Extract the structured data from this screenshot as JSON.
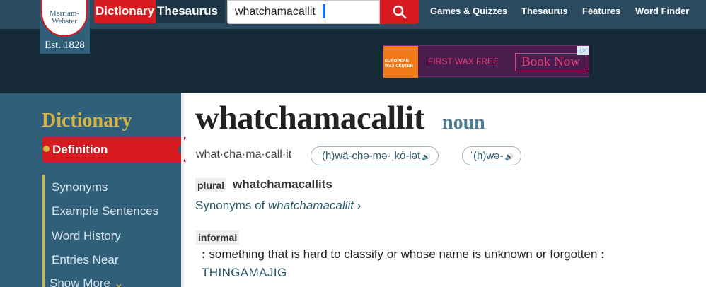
{
  "colors": {
    "brand_red": "#d71920",
    "brand_blue": "#305f7a",
    "gold": "#d6b541",
    "link": "#265667"
  },
  "logo": {
    "line1": "Merriam-",
    "line2": "Webster",
    "est": "Est. 1828"
  },
  "header": {
    "tab_dictionary": "Dictionary",
    "tab_thesaurus": "Thesaurus",
    "search_value": "whatchamacallit",
    "nav": [
      "Games & Quizzes",
      "Thesaurus",
      "Features",
      "Word Finder"
    ]
  },
  "ad": {
    "brand": "EUROPEAN WAX CENTER",
    "offer": "FIRST WAX FREE",
    "cta": "Book Now"
  },
  "sidebar": {
    "title": "Dictionary",
    "active": "Definition",
    "items": [
      "Synonyms",
      "Example Sentences",
      "Word History",
      "Entries Near"
    ],
    "more": "Show More"
  },
  "entry": {
    "headword": "whatchamacallit",
    "part_of_speech": "noun",
    "syllables": "what·cha·ma·call·it",
    "pronunciations": [
      "ˈ(h)wä-chə-mə-ˌkȯ-lət",
      "ˈ(h)wə-"
    ],
    "plural_label": "plural",
    "plural": "whatchamacallits",
    "synonyms_prefix": "Synonyms of ",
    "synonyms_word": "whatchamacallit",
    "usage_label": "informal",
    "definition": "something that is hard to classify or whose name is unknown or forgotten",
    "synonym_ref": "THINGAMAJIG"
  }
}
